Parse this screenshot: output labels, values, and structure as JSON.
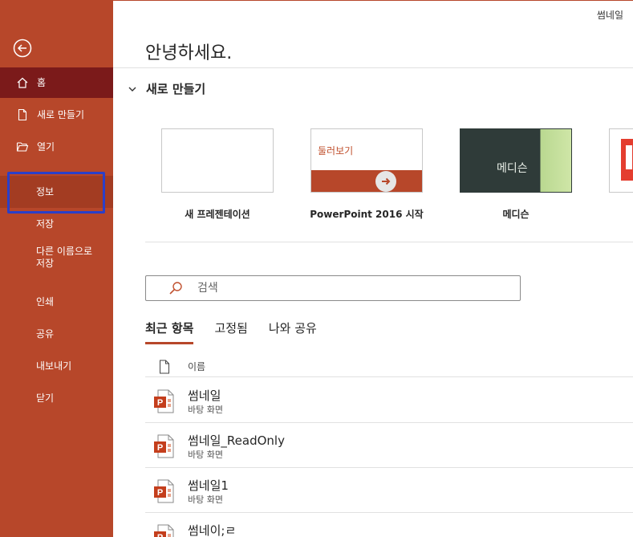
{
  "sidebar": {
    "back_icon": "back-arrow-circle-icon",
    "items": {
      "home": "홈",
      "new": "새로 만들기",
      "open": "열기",
      "info": "정보",
      "save": "저장",
      "save_as_line1": "다른 이름으로",
      "save_as_line2": "저장",
      "print": "인쇄",
      "share": "공유",
      "export": "내보내기",
      "close": "닫기"
    },
    "colors": {
      "background": "#b7472a",
      "selected": "#7b1a1a",
      "highlight_box": "#2b3fc8"
    }
  },
  "header": {
    "user_name": "썸네일",
    "greeting": "안녕하세요."
  },
  "new_section": {
    "title": "새로 만들기",
    "templates": [
      {
        "caption": "새 프레젠테이션"
      },
      {
        "caption": "PowerPoint 2016 시작",
        "thumb_text": "둘러보기"
      },
      {
        "caption": "메디슨",
        "thumb_text": "메디슨"
      }
    ]
  },
  "search": {
    "placeholder": "검색",
    "value": ""
  },
  "tabs": [
    {
      "label": "최근 항목",
      "active": true
    },
    {
      "label": "고정됨",
      "active": false
    },
    {
      "label": "나와 공유",
      "active": false
    }
  ],
  "file_list": {
    "column_name": "이름",
    "rows": [
      {
        "name": "썸네일",
        "location": "바탕 화면"
      },
      {
        "name": "썸네일_ReadOnly",
        "location": "바탕 화면"
      },
      {
        "name": "썸네일1",
        "location": "바탕 화면"
      },
      {
        "name": "썸네이;ㄹ",
        "location": ""
      }
    ]
  }
}
